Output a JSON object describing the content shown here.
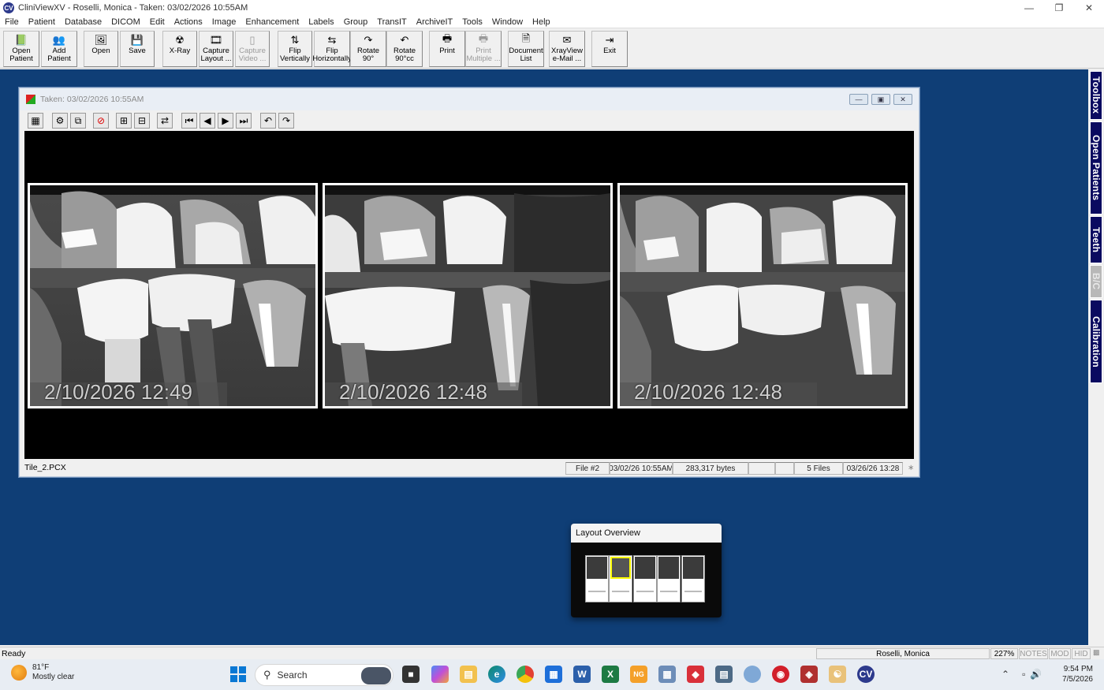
{
  "window": {
    "app_icon": "CV",
    "title": "CliniViewXV - Roselli, Monica - Taken: 03/02/2026  10:55AM",
    "controls": [
      "minimize-icon",
      "restore-icon",
      "close-icon"
    ]
  },
  "menu": [
    "File",
    "Patient",
    "Database",
    "DICOM",
    "Edit",
    "Actions",
    "Image",
    "Enhancement",
    "Labels",
    "Group",
    "TransIT",
    "ArchiveIT",
    "Tools",
    "Window",
    "Help"
  ],
  "toolbar": [
    {
      "label": "Open\nPatient",
      "icon": "open-patient-icon",
      "glyph": "📗",
      "enabled": true
    },
    {
      "label": "Add\nPatient",
      "icon": "add-patient-icon",
      "glyph": "👥",
      "enabled": true
    },
    {
      "label": "Open",
      "icon": "open-icon",
      "glyph": "🖼",
      "enabled": true
    },
    {
      "label": "Save",
      "icon": "save-icon",
      "glyph": "💾",
      "enabled": true
    },
    {
      "label": "X-Ray",
      "icon": "xray-icon",
      "glyph": "☢",
      "enabled": true
    },
    {
      "label": "Capture\nLayout ...",
      "icon": "capture-layout-icon",
      "glyph": "🎞",
      "enabled": true
    },
    {
      "label": "Capture\nVideo ...",
      "icon": "capture-video-icon",
      "glyph": "▯",
      "enabled": false
    },
    {
      "label": "Flip\nVertically",
      "icon": "flip-vertical-icon",
      "glyph": "⇅",
      "enabled": true
    },
    {
      "label": "Flip\nHorizontally",
      "icon": "flip-horizontal-icon",
      "glyph": "⇆",
      "enabled": true
    },
    {
      "label": "Rotate\n90°",
      "icon": "rotate-cw-icon",
      "glyph": "↷",
      "enabled": true
    },
    {
      "label": "Rotate\n90°cc",
      "icon": "rotate-ccw-icon",
      "glyph": "↶",
      "enabled": true
    },
    {
      "label": "Print",
      "icon": "print-icon",
      "glyph": "🖶",
      "enabled": true
    },
    {
      "label": "Print\nMultiple ...",
      "icon": "print-multiple-icon",
      "glyph": "🖶",
      "enabled": false
    },
    {
      "label": "Document\nList",
      "icon": "document-list-icon",
      "glyph": "🗎",
      "enabled": true
    },
    {
      "label": "XrayView\ne-Mail ...",
      "icon": "email-icon",
      "glyph": "✉",
      "enabled": true
    },
    {
      "label": "Exit",
      "icon": "exit-icon",
      "glyph": "⇥",
      "enabled": true
    }
  ],
  "side_tabs": [
    {
      "label": "Toolbox",
      "enabled": true
    },
    {
      "label": "Open Patients",
      "enabled": true
    },
    {
      "label": "Teeth",
      "enabled": true
    },
    {
      "label": "B/C",
      "enabled": false
    },
    {
      "label": "Calibration",
      "enabled": true
    }
  ],
  "image_window": {
    "title": "Taken: 03/02/2026  10:55AM",
    "toolbar_icons": [
      "layout-grid-icon",
      "settings-icon",
      "copy-icon",
      "stop-icon",
      "tile-left-icon",
      "tile-right-icon",
      "swap-icon",
      "first-icon",
      "prev-icon",
      "next-icon",
      "last-icon",
      "undo-icon",
      "redo-icon"
    ],
    "images": [
      {
        "timestamp": "2/10/2026 12:49"
      },
      {
        "timestamp": "2/10/2026 12:48"
      },
      {
        "timestamp": "2/10/2026 12:48"
      }
    ],
    "status": {
      "filename": "Tile_2.PCX",
      "file_num": "File #2",
      "datetime": "03/02/26  10:55AM",
      "size": "283,317 bytes",
      "files": "5 Files",
      "modified": "03/26/26  13:28"
    }
  },
  "layout_overview": {
    "title": "Layout Overview",
    "thumbnails": 5,
    "selected_index": 1
  },
  "app_status": {
    "ready": "Ready",
    "patient": "Roselli, Monica",
    "zoom": "227%",
    "notes": "NOTES",
    "mod": "MOD",
    "hid": "HID"
  },
  "taskbar": {
    "temp": "81°F",
    "weather": "Mostly clear",
    "search_placeholder": "Search",
    "time": "9:54 PM",
    "date": "7/5/2026"
  }
}
